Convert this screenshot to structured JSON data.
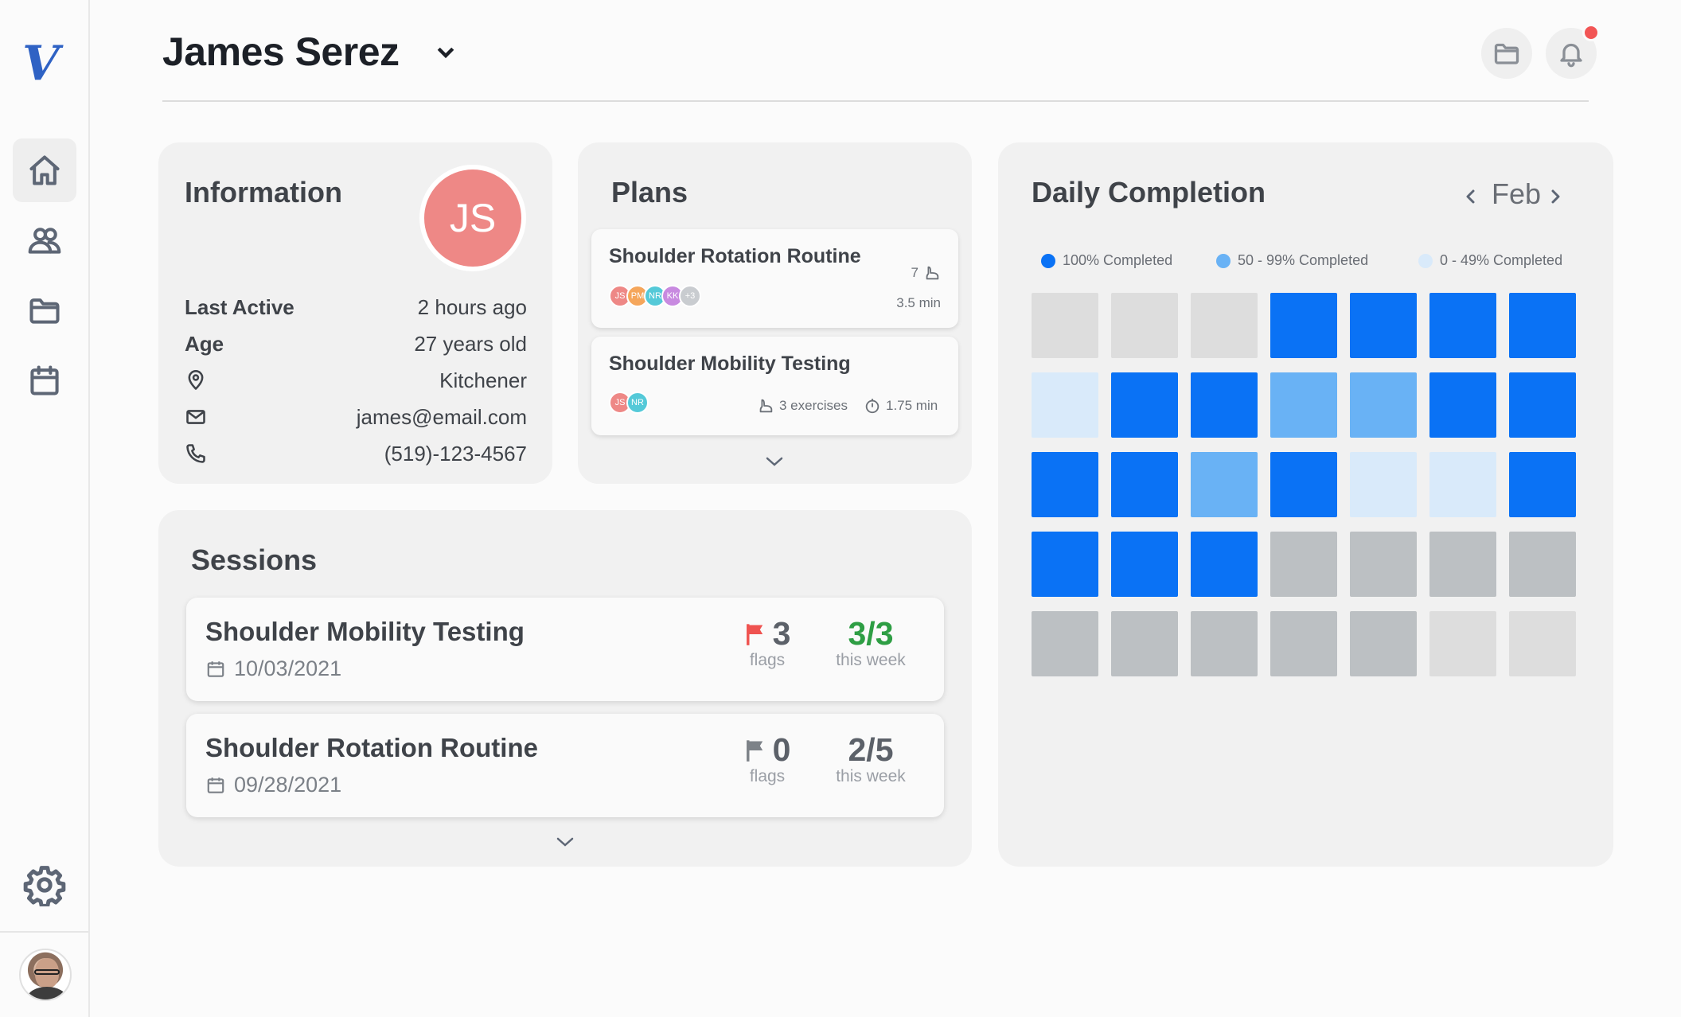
{
  "app": {
    "logo_text": "V"
  },
  "header": {
    "patient_name": "James Serez"
  },
  "sidebar": {
    "items": [
      {
        "name": "home",
        "active": true
      },
      {
        "name": "patients",
        "active": false
      },
      {
        "name": "folder",
        "active": false
      },
      {
        "name": "calendar",
        "active": false
      }
    ]
  },
  "information": {
    "title": "Information",
    "initials": "JS",
    "avatar_color": "#ee8886",
    "last_active_label": "Last Active",
    "last_active_value": "2 hours ago",
    "age_label": "Age",
    "age_value": "27 years old",
    "location": "Kitchener",
    "email": "james@email.com",
    "phone": "(519)-123-4567"
  },
  "plans": {
    "title": "Plans",
    "items": [
      {
        "name": "Shoulder Rotation Routine",
        "avatars": [
          "JS",
          "PM",
          "NR",
          "KK"
        ],
        "extra": "+3",
        "exercises": "7",
        "duration": "3.5 min"
      },
      {
        "name": "Shoulder Mobility Testing",
        "avatars": [
          "JS",
          "NR"
        ],
        "exercises": "3 exercises",
        "duration": "1.75 min"
      }
    ]
  },
  "sessions": {
    "title": "Sessions",
    "items": [
      {
        "name": "Shoulder Mobility Testing",
        "date": "10/03/2021",
        "flags": "3",
        "flags_label": "flags",
        "completion": "3/3",
        "completion_label": "this week",
        "flag_color": "#ef5350",
        "completion_color": "#2e9e44"
      },
      {
        "name": "Shoulder Rotation Routine",
        "date": "09/28/2021",
        "flags": "0",
        "flags_label": "flags",
        "completion": "2/5",
        "completion_label": "this week",
        "flag_color": "#7d8288",
        "completion_color": "#5c6169"
      }
    ]
  },
  "daily_completion": {
    "title": "Daily Completion",
    "month": "Feb",
    "legend": [
      {
        "label": "100% Completed",
        "color": "#0a72f5"
      },
      {
        "label": "50 - 99%  Completed",
        "color": "#69b2f5"
      },
      {
        "label": "0 - 49% Completed",
        "color": "#d9eafa"
      }
    ],
    "colors": {
      "full": "#0a72f5",
      "partial": "#69b2f5",
      "low": "#d9eafa",
      "none": "#bcc0c3",
      "empty": "#dddddd"
    },
    "rows": [
      [
        "empty",
        "empty",
        "empty",
        "full",
        "full",
        "full",
        "full"
      ],
      [
        "low",
        "full",
        "full",
        "partial",
        "partial",
        "full",
        "full"
      ],
      [
        "full",
        "full",
        "partial",
        "full",
        "low",
        "low",
        "full"
      ],
      [
        "full",
        "full",
        "full",
        "none",
        "none",
        "none",
        "none"
      ],
      [
        "none",
        "none",
        "none",
        "none",
        "none",
        "empty",
        "empty"
      ]
    ]
  }
}
